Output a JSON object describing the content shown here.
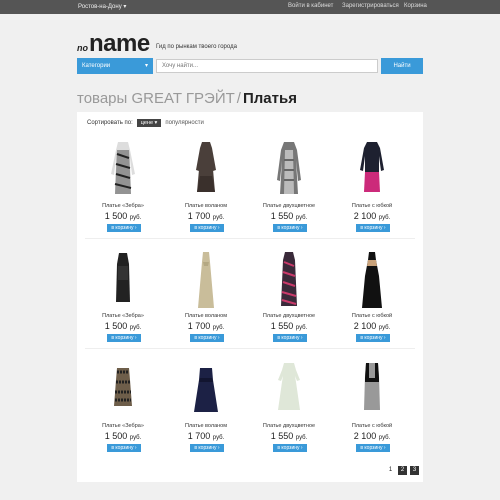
{
  "topbar": {
    "city": "Ростов-на-Дону ▾",
    "login": "Войти в кабинет",
    "register": "Зарегистрироваться",
    "cart": "Корзина"
  },
  "logo": {
    "prefix": "no",
    "name": "name"
  },
  "tagline": "Гид по рынкам твоего города",
  "search": {
    "category_label": "Категории",
    "placeholder": "Хочу найти...",
    "button": "Найти"
  },
  "heading": {
    "section": "товары GREAT ГРЭЙТ",
    "separator": "/",
    "current": "Платья"
  },
  "sort": {
    "label": "Сортировать по:",
    "price": "цене ▾",
    "popularity": "популярности"
  },
  "cart_label": "в корзину ›",
  "currency": "руб.",
  "products": [
    {
      "title": "Платье «Зебра»",
      "price": "1 500"
    },
    {
      "title": "Платье воланом",
      "price": "1 700"
    },
    {
      "title": "Платье двухцветное",
      "price": "1 550"
    },
    {
      "title": "Платье с юбкой",
      "price": "2 100"
    },
    {
      "title": "Платье «Зебра»",
      "price": "1 500"
    },
    {
      "title": "Платье воланом",
      "price": "1 700"
    },
    {
      "title": "Платье двухцветное",
      "price": "1 550"
    },
    {
      "title": "Платье с юбкой",
      "price": "2 100"
    },
    {
      "title": "Платье «Зебра»",
      "price": "1 500"
    },
    {
      "title": "Платье воланом",
      "price": "1 700"
    },
    {
      "title": "Платье двухцветное",
      "price": "1 550"
    },
    {
      "title": "Платье с юбкой",
      "price": "2 100"
    }
  ],
  "pagination": [
    "1",
    "2",
    "3"
  ],
  "colors": {
    "accent": "#3a9ad9",
    "topbar": "#555555"
  }
}
